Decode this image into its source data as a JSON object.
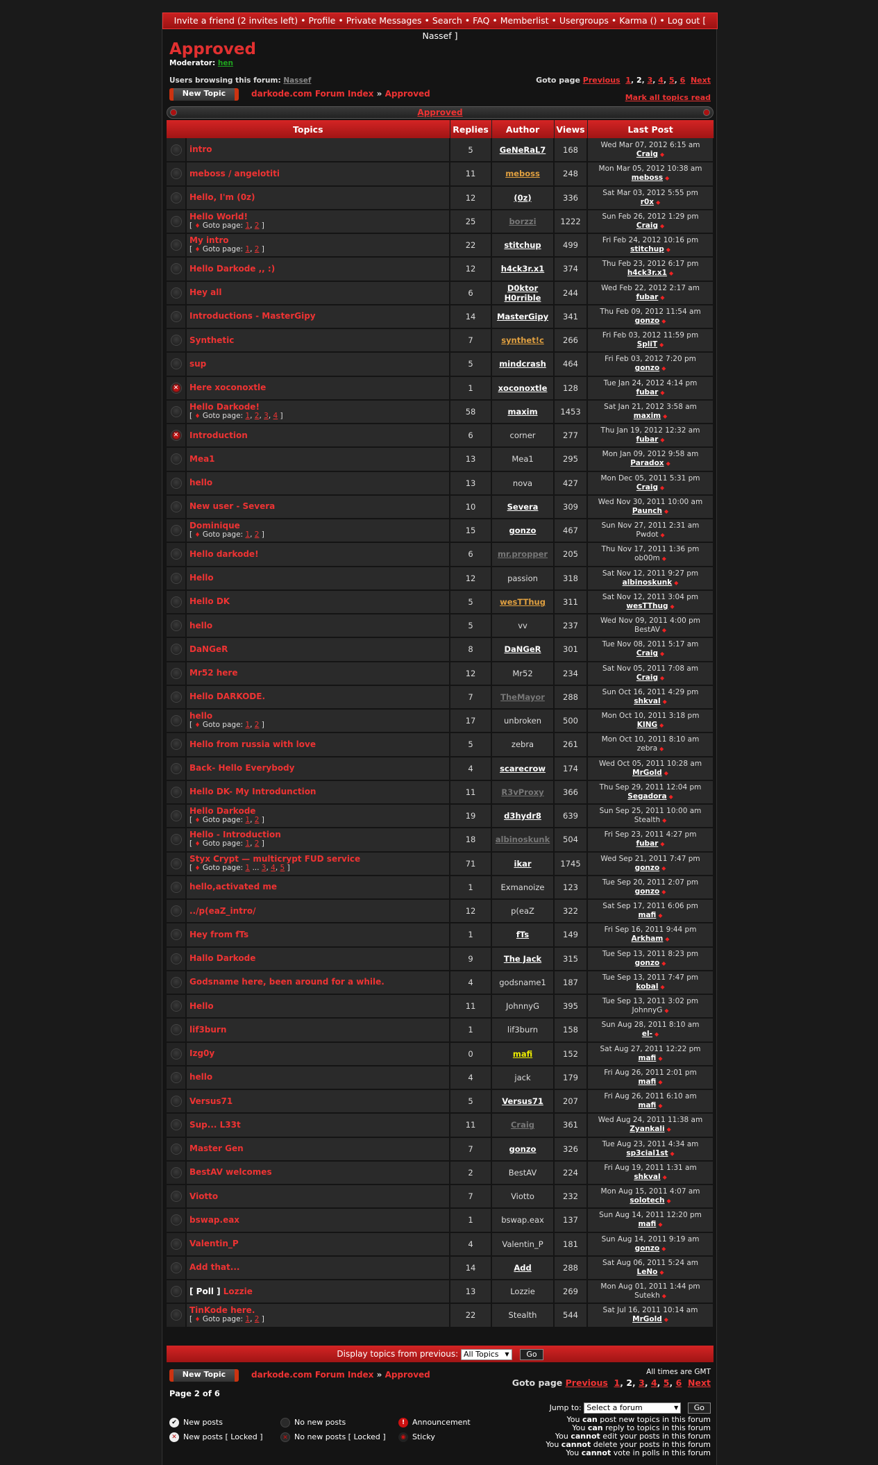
{
  "topnav": {
    "items": [
      "Invite a friend (2 invites left)",
      "Profile",
      "Private Messages",
      "Search",
      "FAQ",
      "Memberlist",
      "Usergroups",
      "Karma ()",
      "Log out [ Nassef ]"
    ]
  },
  "forum": {
    "title": "Approved",
    "moderator_label": "Moderator:",
    "moderator": "hen",
    "browsing_label": "Users browsing this forum:",
    "browsing_user": "Nassef"
  },
  "goto": {
    "label": "Goto page",
    "previous": "Previous",
    "pages": [
      "1",
      "2",
      "3",
      "4",
      "5",
      "6"
    ],
    "current": "2",
    "next": "Next"
  },
  "new_topic_label": "New Topic",
  "breadcrumb": {
    "index": "darkode.com Forum Index",
    "sep": "»",
    "current": "Approved"
  },
  "mark_all": "Mark all topics read",
  "caption": "Approved",
  "headers": [
    "Topics",
    "Replies",
    "Author",
    "Views",
    "Last Post"
  ],
  "goto_page_label": "Goto page:",
  "topics": [
    {
      "title": "intro",
      "replies": "5",
      "author": "GeNeRaL7",
      "as": "u",
      "views": "168",
      "date": "Wed Mar 07, 2012 6:15 am",
      "last": "Craig",
      "ls": "u"
    },
    {
      "title": "meboss / angelotiti",
      "replies": "11",
      "author": "meboss",
      "as": "o",
      "views": "248",
      "date": "Mon Mar 05, 2012 10:38 am",
      "last": "meboss",
      "ls": "u"
    },
    {
      "title": "Hello, I'm (0z)",
      "replies": "12",
      "author": "(0z)",
      "as": "u",
      "views": "336",
      "date": "Sat Mar 03, 2012 5:55 pm",
      "last": "r0x",
      "ls": "u"
    },
    {
      "title": "Hello World!",
      "pages": [
        "1",
        "2"
      ],
      "replies": "25",
      "author": "borzzi",
      "as": "g",
      "views": "1222",
      "date": "Sun Feb 26, 2012 1:29 pm",
      "last": "Craig",
      "ls": "u"
    },
    {
      "title": "My intro",
      "pages": [
        "1",
        "2"
      ],
      "replies": "22",
      "author": "stitchup",
      "as": "u",
      "views": "499",
      "date": "Fri Feb 24, 2012 10:16 pm",
      "last": "stitchup",
      "ls": "u"
    },
    {
      "title": "Hello Darkode ,, :)",
      "replies": "12",
      "author": "h4ck3r.x1",
      "as": "u",
      "views": "374",
      "date": "Thu Feb 23, 2012 6:17 pm",
      "last": "h4ck3r.x1",
      "ls": "u"
    },
    {
      "title": "Hey all",
      "replies": "6",
      "author": "D0ktor H0rrible",
      "as": "u",
      "views": "244",
      "date": "Wed Feb 22, 2012 2:17 am",
      "last": "fubar",
      "ls": "u"
    },
    {
      "title": "Introductions - MasterGipy",
      "replies": "14",
      "author": "MasterGipy",
      "as": "u",
      "views": "341",
      "date": "Thu Feb 09, 2012 11:54 am",
      "last": "gonzo",
      "ls": "u"
    },
    {
      "title": "Synthetic",
      "replies": "7",
      "author": "synthet!c",
      "as": "o",
      "views": "266",
      "date": "Fri Feb 03, 2012 11:59 pm",
      "last": "SpliT",
      "ls": "u"
    },
    {
      "title": "sup",
      "replies": "5",
      "author": "mindcrash",
      "as": "u",
      "views": "464",
      "date": "Fri Feb 03, 2012 7:20 pm",
      "last": "gonzo",
      "ls": "u"
    },
    {
      "title": "Here xoconoxtle",
      "locked": true,
      "replies": "1",
      "author": "xoconoxtle",
      "as": "u",
      "views": "128",
      "date": "Tue Jan 24, 2012 4:14 pm",
      "last": "fubar",
      "ls": "u"
    },
    {
      "title": "Hello Darkode!",
      "pages": [
        "1",
        "2",
        "3",
        "4"
      ],
      "replies": "58",
      "author": "maxim",
      "as": "u",
      "views": "1453",
      "date": "Sat Jan 21, 2012 3:58 am",
      "last": "maxim",
      "ls": "u"
    },
    {
      "title": "Introduction",
      "locked": true,
      "replies": "6",
      "author": "corner",
      "as": "p",
      "views": "277",
      "date": "Thu Jan 19, 2012 12:32 am",
      "last": "fubar",
      "ls": "u"
    },
    {
      "title": "Mea1",
      "replies": "13",
      "author": "Mea1",
      "as": "p",
      "views": "295",
      "date": "Mon Jan 09, 2012 9:58 am",
      "last": "Paradox",
      "ls": "u"
    },
    {
      "title": "hello",
      "replies": "13",
      "author": "nova",
      "as": "p",
      "views": "427",
      "date": "Mon Dec 05, 2011 5:31 pm",
      "last": "Craig",
      "ls": "u"
    },
    {
      "title": "New user - Severa",
      "replies": "10",
      "author": "Severa",
      "as": "u",
      "views": "309",
      "date": "Wed Nov 30, 2011 10:00 am",
      "last": "Paunch",
      "ls": "u"
    },
    {
      "title": "Dominique",
      "pages": [
        "1",
        "2"
      ],
      "replies": "15",
      "author": "gonzo",
      "as": "u",
      "views": "467",
      "date": "Sun Nov 27, 2011 2:31 am",
      "last": "Pwdot",
      "ls": "p"
    },
    {
      "title": "Hello darkode!",
      "replies": "6",
      "author": "mr.propper",
      "as": "g",
      "views": "205",
      "date": "Thu Nov 17, 2011 1:36 pm",
      "last": "ob00m",
      "ls": "p"
    },
    {
      "title": "Hello",
      "replies": "12",
      "author": "passion",
      "as": "p",
      "views": "318",
      "date": "Sat Nov 12, 2011 9:27 pm",
      "last": "albinoskunk",
      "ls": "u"
    },
    {
      "title": "Hello DK",
      "replies": "5",
      "author": "wesTThug",
      "as": "o",
      "views": "311",
      "date": "Sat Nov 12, 2011 3:04 pm",
      "last": "wesTThug",
      "ls": "u"
    },
    {
      "title": "hello",
      "replies": "5",
      "author": "vv",
      "as": "p",
      "views": "237",
      "date": "Wed Nov 09, 2011 4:00 pm",
      "last": "BestAV",
      "ls": "p"
    },
    {
      "title": "DaNGeR",
      "replies": "8",
      "author": "DaNGeR",
      "as": "u",
      "views": "301",
      "date": "Tue Nov 08, 2011 5:17 am",
      "last": "Craig",
      "ls": "u"
    },
    {
      "title": "Mr52 here",
      "replies": "12",
      "author": "Mr52",
      "as": "p",
      "views": "234",
      "date": "Sat Nov 05, 2011 7:08 am",
      "last": "Craig",
      "ls": "u"
    },
    {
      "title": "Hello DARKODE.",
      "replies": "7",
      "author": "TheMayor",
      "as": "g",
      "views": "288",
      "date": "Sun Oct 16, 2011 4:29 pm",
      "last": "shkval",
      "ls": "u"
    },
    {
      "title": "hello",
      "pages": [
        "1",
        "2"
      ],
      "replies": "17",
      "author": "unbroken",
      "as": "p",
      "views": "500",
      "date": "Mon Oct 10, 2011 3:18 pm",
      "last": "KING",
      "ls": "u"
    },
    {
      "title": "Hello from russia with love",
      "replies": "5",
      "author": "zebra",
      "as": "p",
      "views": "261",
      "date": "Mon Oct 10, 2011 8:10 am",
      "last": "zebra",
      "ls": "p"
    },
    {
      "title": "Back- Hello Everybody",
      "replies": "4",
      "author": "scarecrow",
      "as": "u",
      "views": "174",
      "date": "Wed Oct 05, 2011 10:28 am",
      "last": "MrGold",
      "ls": "u"
    },
    {
      "title": "Hello DK- My Introdunction",
      "replies": "11",
      "author": "R3vProxy",
      "as": "g",
      "views": "366",
      "date": "Thu Sep 29, 2011 12:04 pm",
      "last": "Segadora",
      "ls": "u"
    },
    {
      "title": "Hello Darkode",
      "pages": [
        "1",
        "2"
      ],
      "replies": "19",
      "author": "d3hydr8",
      "as": "u",
      "views": "639",
      "date": "Sun Sep 25, 2011 10:00 am",
      "last": "Stealth",
      "ls": "p"
    },
    {
      "title": "Hello - Introduction",
      "pages": [
        "1",
        "2"
      ],
      "replies": "18",
      "author": "albinoskunk",
      "as": "g",
      "views": "504",
      "date": "Fri Sep 23, 2011 4:27 pm",
      "last": "fubar",
      "ls": "u"
    },
    {
      "title": "Styx Crypt — multicrypt FUD service",
      "pages": [
        "1",
        "...",
        "3",
        "4",
        "5"
      ],
      "replies": "71",
      "author": "ikar",
      "as": "u",
      "views": "1745",
      "date": "Wed Sep 21, 2011 7:47 pm",
      "last": "gonzo",
      "ls": "u"
    },
    {
      "title": "hello,activated me",
      "replies": "1",
      "author": "Exmanoize",
      "as": "p",
      "views": "123",
      "date": "Tue Sep 20, 2011 2:07 pm",
      "last": "gonzo",
      "ls": "u"
    },
    {
      "title": "../p(eaZ_intro/",
      "replies": "12",
      "author": "p(eaZ",
      "as": "p",
      "views": "322",
      "date": "Sat Sep 17, 2011 6:06 pm",
      "last": "mafi",
      "ls": "u"
    },
    {
      "title": "Hey from fTs",
      "replies": "1",
      "author": "fTs",
      "as": "u",
      "views": "149",
      "date": "Fri Sep 16, 2011 9:44 pm",
      "last": "Arkham",
      "ls": "u"
    },
    {
      "title": "Hallo Darkode",
      "replies": "9",
      "author": "The Jack",
      "as": "u",
      "views": "315",
      "date": "Tue Sep 13, 2011 8:23 pm",
      "last": "gonzo",
      "ls": "u"
    },
    {
      "title": "Godsname here, been around for a while.",
      "replies": "4",
      "author": "godsname1",
      "as": "p",
      "views": "187",
      "date": "Tue Sep 13, 2011 7:47 pm",
      "last": "kobal",
      "ls": "u"
    },
    {
      "title": "Hello",
      "replies": "11",
      "author": "JohnnyG",
      "as": "p",
      "views": "395",
      "date": "Tue Sep 13, 2011 3:02 pm",
      "last": "JohnnyG",
      "ls": "p"
    },
    {
      "title": "lif3burn",
      "replies": "1",
      "author": "lif3burn",
      "as": "p",
      "views": "158",
      "date": "Sun Aug 28, 2011 8:10 am",
      "last": "el-",
      "ls": "u"
    },
    {
      "title": "Izg0y",
      "replies": "0",
      "author": "mafi",
      "as": "y",
      "views": "152",
      "date": "Sat Aug 27, 2011 12:22 pm",
      "last": "mafi",
      "ls": "u"
    },
    {
      "title": "hello",
      "replies": "4",
      "author": "jack",
      "as": "p",
      "views": "179",
      "date": "Fri Aug 26, 2011 2:01 pm",
      "last": "mafi",
      "ls": "u"
    },
    {
      "title": "Versus71",
      "replies": "5",
      "author": "Versus71",
      "as": "u",
      "views": "207",
      "date": "Fri Aug 26, 2011 6:10 am",
      "last": "mafi",
      "ls": "u"
    },
    {
      "title": "Sup... L33t",
      "replies": "11",
      "author": "Craig",
      "as": "g",
      "views": "361",
      "date": "Wed Aug 24, 2011 11:38 am",
      "last": "Zyankali",
      "ls": "u"
    },
    {
      "title": "Master Gen",
      "replies": "7",
      "author": "gonzo",
      "as": "u",
      "views": "326",
      "date": "Tue Aug 23, 2011 4:34 am",
      "last": "sp3cial1st",
      "ls": "u"
    },
    {
      "title": "BestAV welcomes",
      "replies": "2",
      "author": "BestAV",
      "as": "p",
      "views": "224",
      "date": "Fri Aug 19, 2011 1:31 am",
      "last": "shkval",
      "ls": "u"
    },
    {
      "title": "Viotto",
      "replies": "7",
      "author": "Viotto",
      "as": "p",
      "views": "232",
      "date": "Mon Aug 15, 2011 4:07 am",
      "last": "solotech",
      "ls": "u"
    },
    {
      "title": "bswap.eax",
      "replies": "1",
      "author": "bswap.eax",
      "as": "p",
      "views": "137",
      "date": "Sun Aug 14, 2011 12:20 pm",
      "last": "mafi",
      "ls": "u"
    },
    {
      "title": "Valentin_P",
      "replies": "4",
      "author": "Valentin_P",
      "as": "p",
      "views": "181",
      "date": "Sun Aug 14, 2011 9:19 am",
      "last": "gonzo",
      "ls": "u"
    },
    {
      "title": "Add that...",
      "replies": "14",
      "author": "Add",
      "as": "u",
      "views": "288",
      "date": "Sat Aug 06, 2011 5:24 am",
      "last": "LeNo",
      "ls": "u"
    },
    {
      "title": "Lozzie",
      "poll": "[ Poll ]",
      "replies": "13",
      "author": "Lozzie",
      "as": "p",
      "views": "269",
      "date": "Mon Aug 01, 2011 1:44 pm",
      "last": "Sutekh",
      "ls": "p"
    },
    {
      "title": "TinKode here.",
      "pages": [
        "1",
        "2"
      ],
      "replies": "22",
      "author": "Stealth",
      "as": "p",
      "views": "544",
      "date": "Sat Jul 16, 2011 10:14 am",
      "last": "MrGold",
      "ls": "u"
    }
  ],
  "display_bar": {
    "label": "Display topics from previous:",
    "selected": "All Topics",
    "go": "Go"
  },
  "times": "All times are GMT",
  "page_of": "Page 2 of 6",
  "legend": {
    "new_posts": "New posts",
    "no_new_posts": "No new posts",
    "announcement": "Announcement",
    "new_posts_locked": "New posts [ Locked ]",
    "no_new_posts_locked": "No new posts [ Locked ]",
    "sticky": "Sticky"
  },
  "jump": {
    "label": "Jump to:",
    "selected": "Select a forum",
    "go": "Go"
  },
  "perms": [
    [
      "You ",
      "can",
      " post new topics in this forum"
    ],
    [
      "You ",
      "can",
      " reply to topics in this forum"
    ],
    [
      "You ",
      "cannot",
      " edit your posts in this forum"
    ],
    [
      "You ",
      "cannot",
      " delete your posts in this forum"
    ],
    [
      "You ",
      "cannot",
      " vote in polls in this forum"
    ]
  ],
  "colors": {
    "accent": "#e23030",
    "bar": "#b81a1a",
    "bg": "#141414"
  }
}
